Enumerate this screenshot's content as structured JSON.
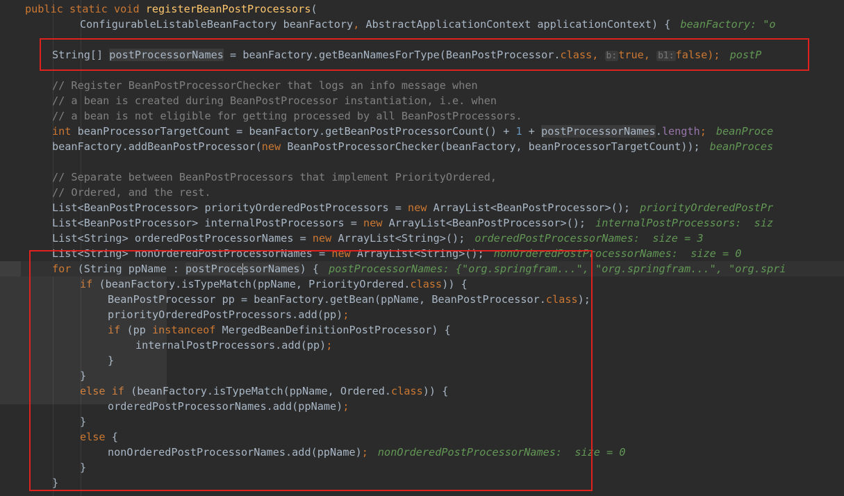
{
  "editor": {
    "header": {
      "l1": {
        "kw": "public static void ",
        "method": "registerBeanPostProcessors",
        "rest": "("
      },
      "l2": {
        "t1": "ConfigurableListableBeanFactory beanFactory",
        "t2": ", ",
        "t3": "AbstractApplicationContext applicationContext) {",
        "hint": "beanFactory: \"o"
      }
    },
    "l3": {
      "t1": "String[] ",
      "var": "postProcessorNames",
      "t2": " = beanFactory.getBeanNamesForType(BeanPostProcessor.",
      "kw_class": "class",
      "t3": ", ",
      "p1": "b:",
      "v1": "true",
      "t4": ", ",
      "p2": "b1:",
      "v2": "false",
      "t5": ");",
      "hint": "postP"
    },
    "comment1": [
      "// Register BeanPostProcessorChecker that logs an info message when",
      "// a bean is created during BeanPostProcessor instantiation, i.e. when",
      "// a bean is not eligible for getting processed by all BeanPostProcessors."
    ],
    "l7": {
      "kw": "int ",
      "t1": "beanProcessorTargetCount = beanFactory.getBeanPostProcessorCount() + ",
      "num": "1",
      "t2": " + ",
      "var": "postProcessorNames",
      "t3": ".",
      "field": "length",
      "t4": ";",
      "hint": "beanProce"
    },
    "l8": {
      "t1": "beanFactory.addBeanPostProcessor(",
      "kw": "new ",
      "t2": "BeanPostProcessorChecker(beanFactory, beanProcessorTargetCount));",
      "hint": "beanProces"
    },
    "comment2": [
      "// Separate between BeanPostProcessors that implement PriorityOrdered,",
      "// Ordered, and the rest."
    ],
    "l12": {
      "t1": "List<BeanPostProcessor> priorityOrderedPostProcessors = ",
      "kw": "new ",
      "t2": "ArrayList<BeanPostProcessor>();",
      "hint": "priorityOrderedPostPr"
    },
    "l13": {
      "t1": "List<BeanPostProcessor> internalPostProcessors = ",
      "kw": "new ",
      "t2": "ArrayList<BeanPostProcessor>();",
      "hint": "internalPostProcessors:  siz"
    },
    "l14": {
      "t1": "List<String> orderedPostProcessorNames = ",
      "kw": "new ",
      "t2": "ArrayList<String>();",
      "hint": "orderedPostProcessorNames:  size = 3"
    },
    "l15": {
      "t1": "List<String> nonOrderedPostProcessorNames = ",
      "kw": "new ",
      "t2": "ArrayList<String>();",
      "hint": "nonOrderedPostProcessorNames:  size = 0"
    },
    "l16": {
      "kw": "for ",
      "t1": "(String ppName : ",
      "var_a": "postProce",
      "var_b": "ssorNames",
      "t2": ") {",
      "hint": "postProcessorNames: {\"org.springfram...\", \"org.springfram...\", \"org.spri"
    },
    "l17": {
      "kw": "if ",
      "t1": "(beanFactory.isTypeMatch(ppName, PriorityOrdered.",
      "kw_class": "class",
      "t2": ")) {"
    },
    "l18": {
      "t1": "BeanPostProcessor pp = beanFactory.getBean(ppName, BeanPostProcessor.",
      "kw_class": "class",
      "t2": ");"
    },
    "l19": {
      "t1": "priorityOrderedPostProcessors.add(pp)",
      "t2": ";"
    },
    "l20": {
      "kw": "if ",
      "t1": "(pp ",
      "kw2": "instanceof ",
      "t2": "MergedBeanDefinitionPostProcessor) {"
    },
    "l21": {
      "t1": "internalPostProcessors.add(pp)",
      "t2": ";"
    },
    "l22": "}",
    "l23": "}",
    "l24": {
      "kw": "else if ",
      "t1": "(beanFactory.isTypeMatch(ppName, Ordered.",
      "kw_class": "class",
      "t2": ")) {"
    },
    "l25": {
      "t1": "orderedPostProcessorNames.add(ppName)",
      "t2": ";"
    },
    "l26": "}",
    "l27": {
      "kw": "else ",
      "t1": "{"
    },
    "l28": {
      "t1": "nonOrderedPostProcessorNames.add(ppName)",
      "t2": ";",
      "hint": "nonOrderedPostProcessorNames:  size = 0"
    },
    "l29": "}",
    "l30": "}"
  },
  "colors": {
    "background": "#2b2b2b",
    "keyword": "#cc7832",
    "comment": "#808080",
    "method": "#ffc66d",
    "field": "#9876aa",
    "number": "#6897bb",
    "inline_hint": "#629755",
    "annotation_box": "#e0221e"
  }
}
